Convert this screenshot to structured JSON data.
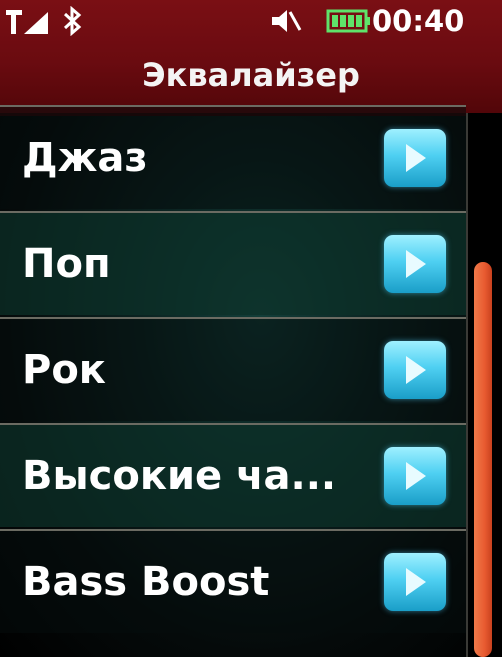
{
  "status_bar": {
    "time": "00:40",
    "icons": [
      "signal-icon",
      "bluetooth-icon",
      "mute-icon",
      "battery-icon"
    ]
  },
  "header": {
    "title": "Эквалайзер"
  },
  "equalizer_list": {
    "items": [
      {
        "label": "Джаз"
      },
      {
        "label": "Поп"
      },
      {
        "label": "Рок"
      },
      {
        "label": "Высокие ча..."
      },
      {
        "label": "Bass Boost"
      }
    ]
  },
  "colors": {
    "header_bg": "#6a0b10",
    "play_button": "#4fd0f2",
    "scroll_thumb": "#e85a30",
    "battery": "#5fe36a"
  }
}
